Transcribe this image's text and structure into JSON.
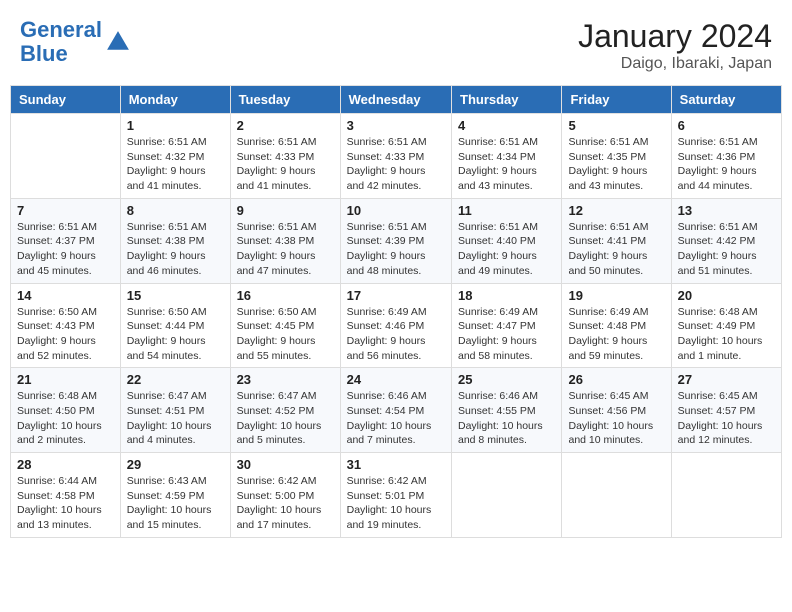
{
  "header": {
    "logo_line1": "General",
    "logo_line2": "Blue",
    "title": "January 2024",
    "subtitle": "Daigo, Ibaraki, Japan"
  },
  "columns": [
    "Sunday",
    "Monday",
    "Tuesday",
    "Wednesday",
    "Thursday",
    "Friday",
    "Saturday"
  ],
  "weeks": [
    [
      {
        "day": "",
        "info": ""
      },
      {
        "day": "1",
        "info": "Sunrise: 6:51 AM\nSunset: 4:32 PM\nDaylight: 9 hours\nand 41 minutes."
      },
      {
        "day": "2",
        "info": "Sunrise: 6:51 AM\nSunset: 4:33 PM\nDaylight: 9 hours\nand 41 minutes."
      },
      {
        "day": "3",
        "info": "Sunrise: 6:51 AM\nSunset: 4:33 PM\nDaylight: 9 hours\nand 42 minutes."
      },
      {
        "day": "4",
        "info": "Sunrise: 6:51 AM\nSunset: 4:34 PM\nDaylight: 9 hours\nand 43 minutes."
      },
      {
        "day": "5",
        "info": "Sunrise: 6:51 AM\nSunset: 4:35 PM\nDaylight: 9 hours\nand 43 minutes."
      },
      {
        "day": "6",
        "info": "Sunrise: 6:51 AM\nSunset: 4:36 PM\nDaylight: 9 hours\nand 44 minutes."
      }
    ],
    [
      {
        "day": "7",
        "info": "Sunrise: 6:51 AM\nSunset: 4:37 PM\nDaylight: 9 hours\nand 45 minutes."
      },
      {
        "day": "8",
        "info": "Sunrise: 6:51 AM\nSunset: 4:38 PM\nDaylight: 9 hours\nand 46 minutes."
      },
      {
        "day": "9",
        "info": "Sunrise: 6:51 AM\nSunset: 4:38 PM\nDaylight: 9 hours\nand 47 minutes."
      },
      {
        "day": "10",
        "info": "Sunrise: 6:51 AM\nSunset: 4:39 PM\nDaylight: 9 hours\nand 48 minutes."
      },
      {
        "day": "11",
        "info": "Sunrise: 6:51 AM\nSunset: 4:40 PM\nDaylight: 9 hours\nand 49 minutes."
      },
      {
        "day": "12",
        "info": "Sunrise: 6:51 AM\nSunset: 4:41 PM\nDaylight: 9 hours\nand 50 minutes."
      },
      {
        "day": "13",
        "info": "Sunrise: 6:51 AM\nSunset: 4:42 PM\nDaylight: 9 hours\nand 51 minutes."
      }
    ],
    [
      {
        "day": "14",
        "info": "Sunrise: 6:50 AM\nSunset: 4:43 PM\nDaylight: 9 hours\nand 52 minutes."
      },
      {
        "day": "15",
        "info": "Sunrise: 6:50 AM\nSunset: 4:44 PM\nDaylight: 9 hours\nand 54 minutes."
      },
      {
        "day": "16",
        "info": "Sunrise: 6:50 AM\nSunset: 4:45 PM\nDaylight: 9 hours\nand 55 minutes."
      },
      {
        "day": "17",
        "info": "Sunrise: 6:49 AM\nSunset: 4:46 PM\nDaylight: 9 hours\nand 56 minutes."
      },
      {
        "day": "18",
        "info": "Sunrise: 6:49 AM\nSunset: 4:47 PM\nDaylight: 9 hours\nand 58 minutes."
      },
      {
        "day": "19",
        "info": "Sunrise: 6:49 AM\nSunset: 4:48 PM\nDaylight: 9 hours\nand 59 minutes."
      },
      {
        "day": "20",
        "info": "Sunrise: 6:48 AM\nSunset: 4:49 PM\nDaylight: 10 hours\nand 1 minute."
      }
    ],
    [
      {
        "day": "21",
        "info": "Sunrise: 6:48 AM\nSunset: 4:50 PM\nDaylight: 10 hours\nand 2 minutes."
      },
      {
        "day": "22",
        "info": "Sunrise: 6:47 AM\nSunset: 4:51 PM\nDaylight: 10 hours\nand 4 minutes."
      },
      {
        "day": "23",
        "info": "Sunrise: 6:47 AM\nSunset: 4:52 PM\nDaylight: 10 hours\nand 5 minutes."
      },
      {
        "day": "24",
        "info": "Sunrise: 6:46 AM\nSunset: 4:54 PM\nDaylight: 10 hours\nand 7 minutes."
      },
      {
        "day": "25",
        "info": "Sunrise: 6:46 AM\nSunset: 4:55 PM\nDaylight: 10 hours\nand 8 minutes."
      },
      {
        "day": "26",
        "info": "Sunrise: 6:45 AM\nSunset: 4:56 PM\nDaylight: 10 hours\nand 10 minutes."
      },
      {
        "day": "27",
        "info": "Sunrise: 6:45 AM\nSunset: 4:57 PM\nDaylight: 10 hours\nand 12 minutes."
      }
    ],
    [
      {
        "day": "28",
        "info": "Sunrise: 6:44 AM\nSunset: 4:58 PM\nDaylight: 10 hours\nand 13 minutes."
      },
      {
        "day": "29",
        "info": "Sunrise: 6:43 AM\nSunset: 4:59 PM\nDaylight: 10 hours\nand 15 minutes."
      },
      {
        "day": "30",
        "info": "Sunrise: 6:42 AM\nSunset: 5:00 PM\nDaylight: 10 hours\nand 17 minutes."
      },
      {
        "day": "31",
        "info": "Sunrise: 6:42 AM\nSunset: 5:01 PM\nDaylight: 10 hours\nand 19 minutes."
      },
      {
        "day": "",
        "info": ""
      },
      {
        "day": "",
        "info": ""
      },
      {
        "day": "",
        "info": ""
      }
    ]
  ]
}
